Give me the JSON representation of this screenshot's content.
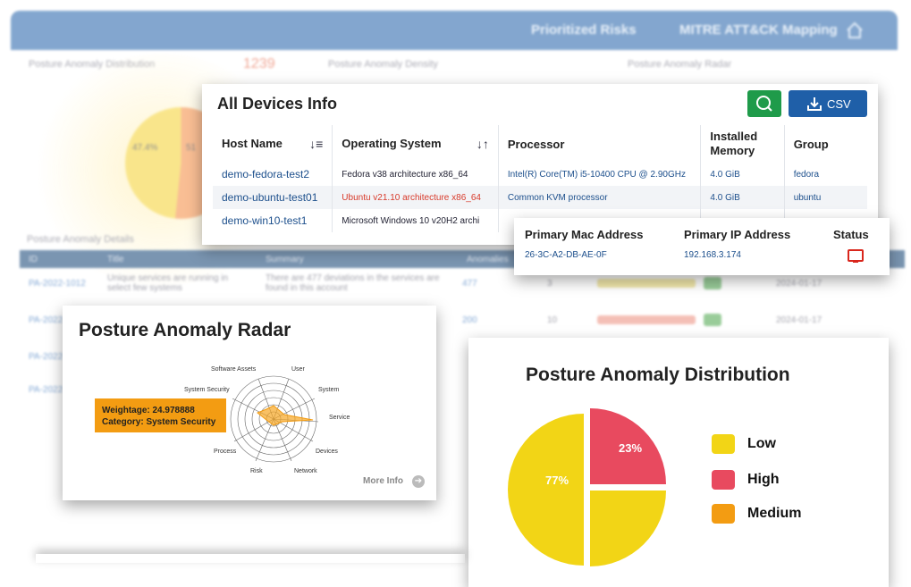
{
  "background": {
    "nav": [
      "Prioritized Risks",
      "MITRE ATT&CK Mapping"
    ],
    "panels": {
      "distribution_title": "Posture Anomaly Distribution",
      "distribution_count": "1239",
      "density_title": "Posture Anomaly Density",
      "radar_title": "Posture Anomaly Radar",
      "pie_labels": [
        "47.4%",
        "51"
      ]
    },
    "details": {
      "title": "Posture Anomaly Details",
      "headers": [
        "ID",
        "Title",
        "Summary",
        "Anomalies"
      ],
      "rows": [
        {
          "id": "PA-2022-1012",
          "title": "Unique services are running in select few systems",
          "summary": "There are 477 deviations in the services are found in this account",
          "more": "more",
          "anomalies": "477",
          "count": "3",
          "date": "2024-01-17"
        },
        {
          "id": "PA-2022-",
          "title": "",
          "summary": "",
          "anomalies": "200",
          "count": "10",
          "bar": "200",
          "date": "2024-01-17"
        },
        {
          "id": "PA-2022-",
          "title": "",
          "summary": "",
          "anomalies": "",
          "count": "",
          "date": ""
        },
        {
          "id": "PA-2022-",
          "title": "",
          "summary": "",
          "anomalies": "",
          "count": "",
          "date": ""
        }
      ]
    }
  },
  "devices": {
    "title": "All Devices Info",
    "csv_label": "CSV",
    "columns": [
      "Host Name",
      "Operating System",
      "Processor",
      "Installed Memory",
      "Group"
    ],
    "rows": [
      {
        "host": "demo-fedora-test2",
        "os": "Fedora v38 architecture x86_64",
        "cpu": "Intel(R) Core(TM) i5-10400 CPU @ 2.90GHz",
        "mem": "4.0 GiB",
        "group": "fedora"
      },
      {
        "host": "demo-ubuntu-test01",
        "os": "Ubuntu v21.10 architecture x86_64",
        "cpu": "Common KVM processor",
        "mem": "4.0 GiB",
        "group": "ubuntu"
      },
      {
        "host": "demo-win10-test1",
        "os": "Microsoft Windows 10 v20H2 archi",
        "cpu": "",
        "mem": "",
        "group": ""
      }
    ]
  },
  "mac_panel": {
    "headers": [
      "Primary Mac Address",
      "Primary IP Address",
      "Status"
    ],
    "mac": "26-3C-A2-DB-AE-0F",
    "ip": "192.168.3.174"
  },
  "radar": {
    "title": "Posture Anomaly Radar",
    "axes": [
      "Software Assets",
      "User",
      "System Security",
      "System",
      "Service",
      "Devices",
      "Process",
      "Risk",
      "Network"
    ],
    "tooltip": {
      "weightage": "Weightage: 24.978888",
      "category": "Category: System Security"
    },
    "more_info": "More Info"
  },
  "distribution": {
    "title": "Posture Anomaly Distribution",
    "slices": [
      {
        "label": "77%",
        "value": 77,
        "color": "#f2d516"
      },
      {
        "label": "23%",
        "value": 23,
        "color": "#e84a5f"
      }
    ],
    "legend": [
      {
        "name": "Low",
        "color": "#f2d516"
      },
      {
        "name": "High",
        "color": "#e84a5f"
      },
      {
        "name": "Medium",
        "color": "#f39c12"
      }
    ]
  }
}
